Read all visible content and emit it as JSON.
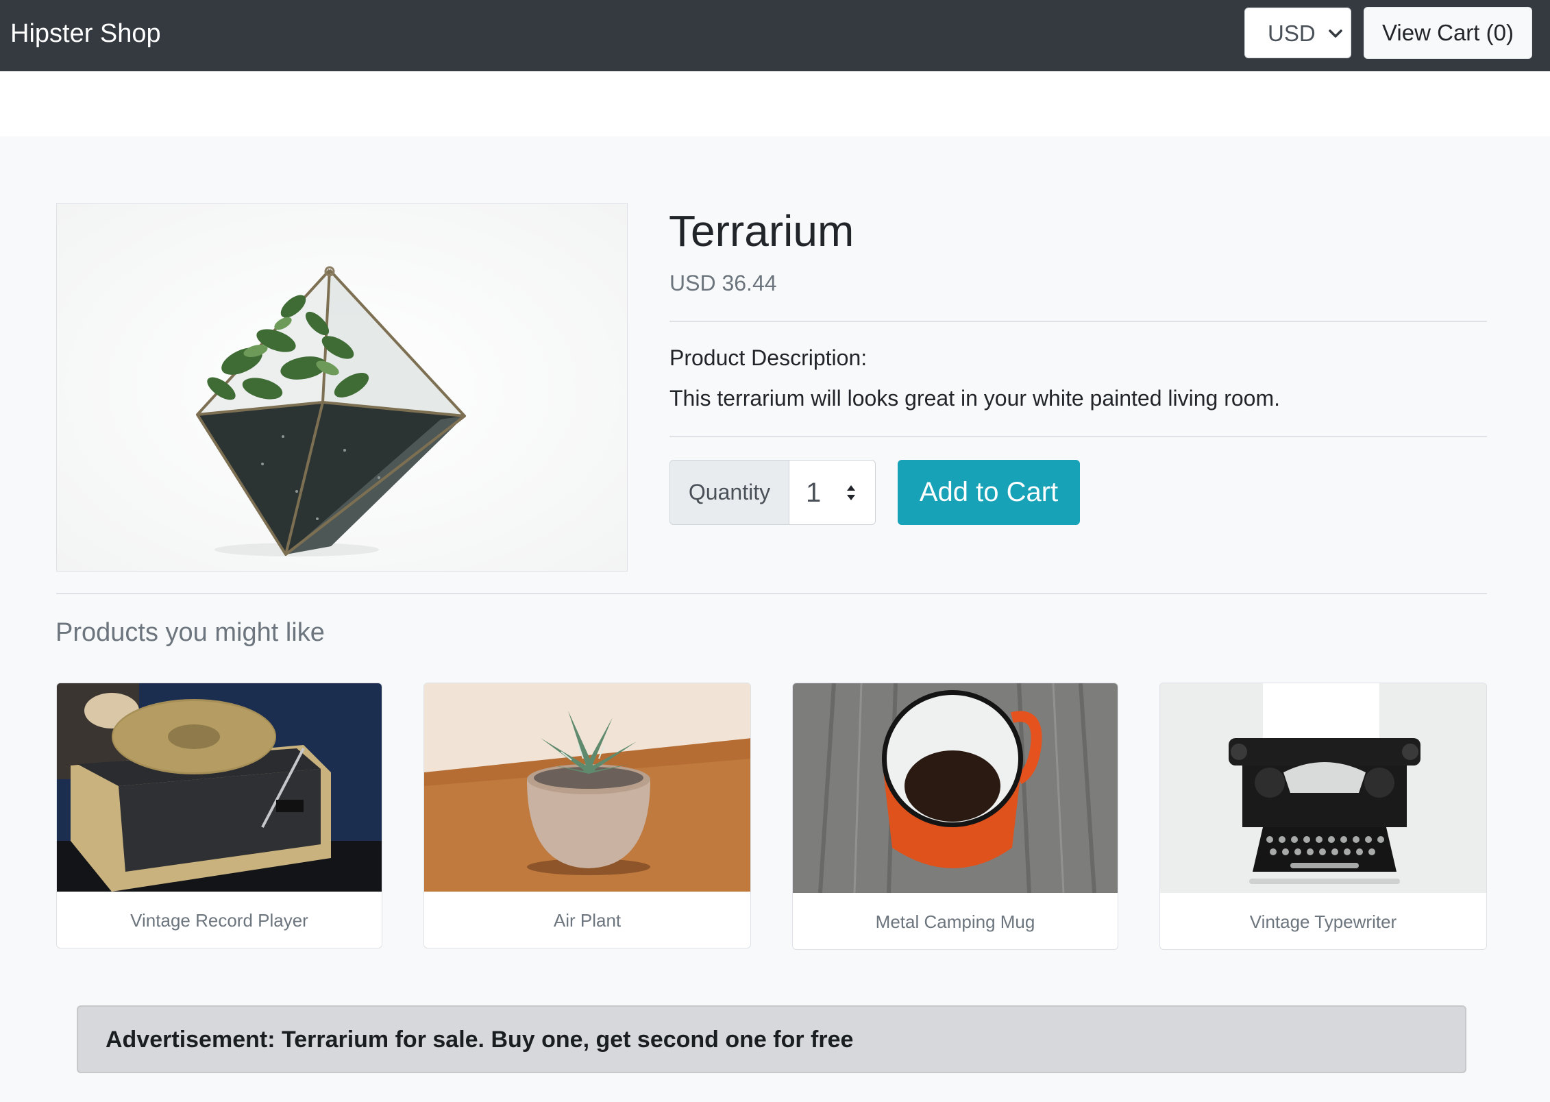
{
  "navbar": {
    "brand": "Hipster Shop",
    "currency": {
      "selected": "USD"
    },
    "cart_button": "View Cart (0)"
  },
  "product": {
    "name": "Terrarium",
    "price": "USD 36.44",
    "description_heading": "Product Description:",
    "description": "This terrarium will looks great in your white painted living room.",
    "quantity_label": "Quantity",
    "quantity_value": "1",
    "add_to_cart": "Add to Cart"
  },
  "recommendations": {
    "heading": "Products you might like",
    "items": [
      {
        "name": "Vintage Record Player"
      },
      {
        "name": "Air Plant"
      },
      {
        "name": "Metal Camping Mug"
      },
      {
        "name": "Vintage Typewriter"
      }
    ]
  },
  "ad": {
    "text": "Advertisement: Terrarium for sale. Buy one, get second one for free"
  },
  "colors": {
    "navbar_bg": "#343a40",
    "accent": "#17a2b8",
    "page_bg": "#f8f9fa",
    "ad_bg": "#d6d8db"
  }
}
